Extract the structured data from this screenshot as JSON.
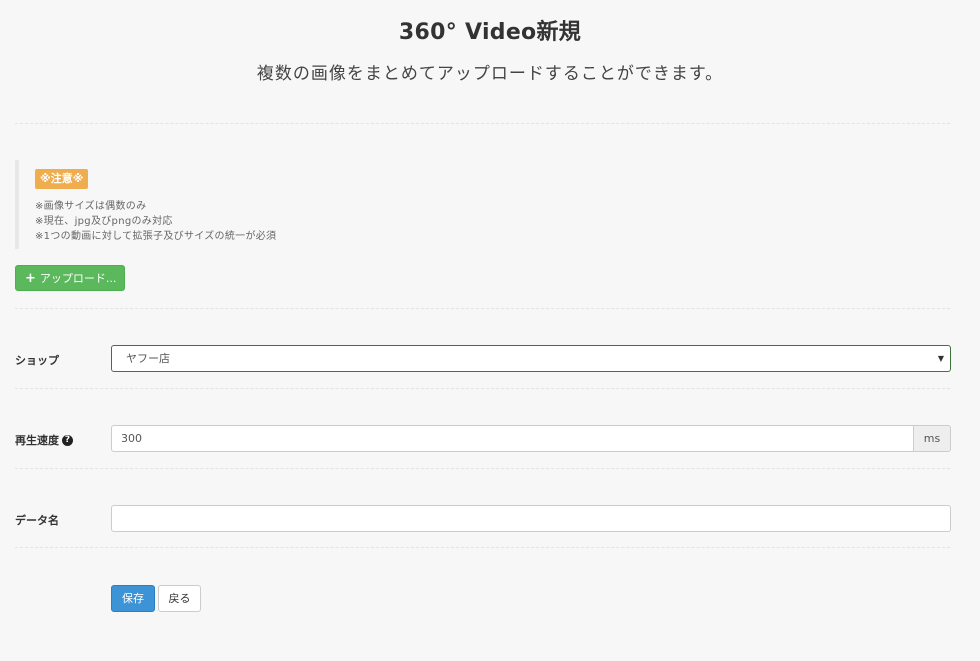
{
  "header": {
    "title": "360° Video新規",
    "subtitle": "複数の画像をまとめてアップロードすることができます。"
  },
  "notice": {
    "badge": "※注意※",
    "lines": [
      "※画像サイズは偶数のみ",
      "※現在、jpg及びpngのみ対応",
      "※1つの動画に対して拡張子及びサイズの統一が必須"
    ]
  },
  "upload": {
    "icon": "plus-icon",
    "label": "アップロード..."
  },
  "form": {
    "shop": {
      "label": "ショップ",
      "value": "ヤフー店"
    },
    "speed": {
      "label": "再生速度",
      "help_icon": "question-circle-icon",
      "value": "300",
      "unit": "ms"
    },
    "data_name": {
      "label": "データ名",
      "value": ""
    }
  },
  "actions": {
    "save_label": "保存",
    "back_label": "戻る"
  },
  "colors": {
    "upload_green": "#5cb85c",
    "save_blue": "#3c94d7",
    "notice_orange": "#f0ad4e",
    "select_border_green": "#3c763d"
  }
}
